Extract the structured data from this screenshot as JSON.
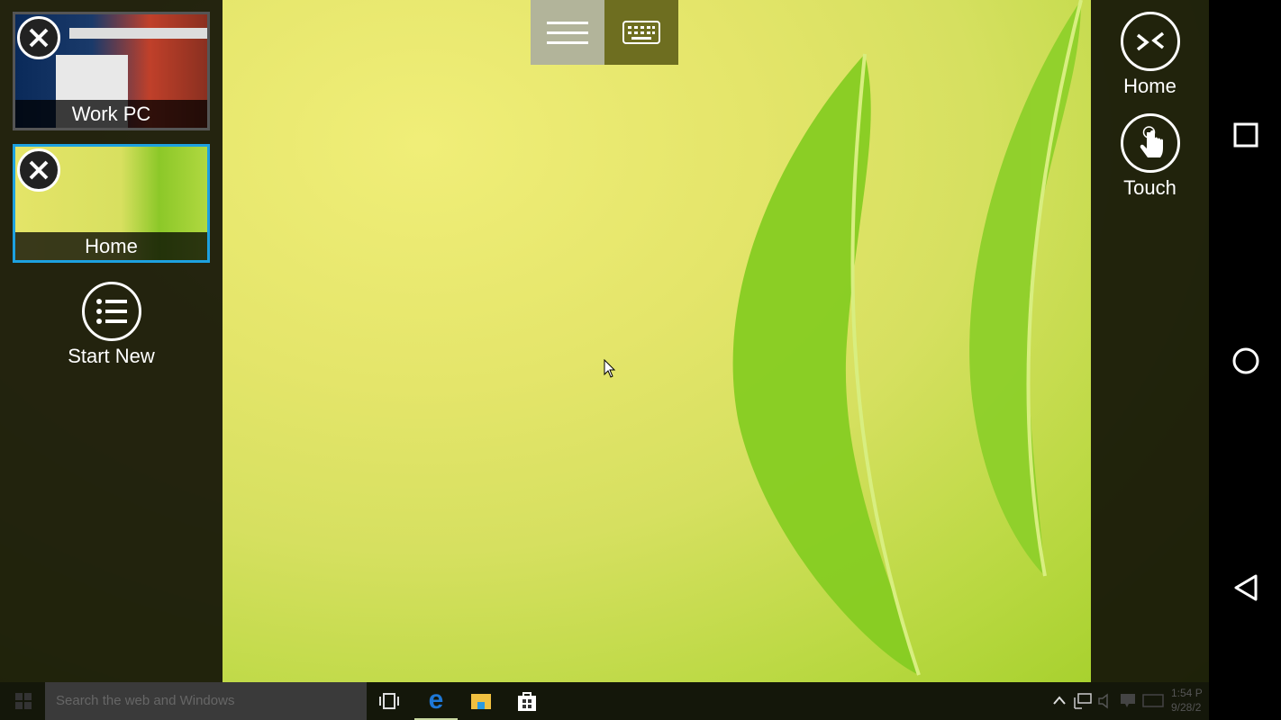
{
  "sessions": [
    {
      "label": "Work PC",
      "active": false
    },
    {
      "label": "Home",
      "active": true
    }
  ],
  "start_new_label": "Start New",
  "right_panel": {
    "home_label": "Home",
    "touch_label": "Touch"
  },
  "taskbar": {
    "search_placeholder": "Search the web and Windows",
    "time": "1:54 P",
    "date": "9/28/2"
  },
  "colors": {
    "active_border": "#1da1e0",
    "edge_blue": "#1e78d7"
  }
}
